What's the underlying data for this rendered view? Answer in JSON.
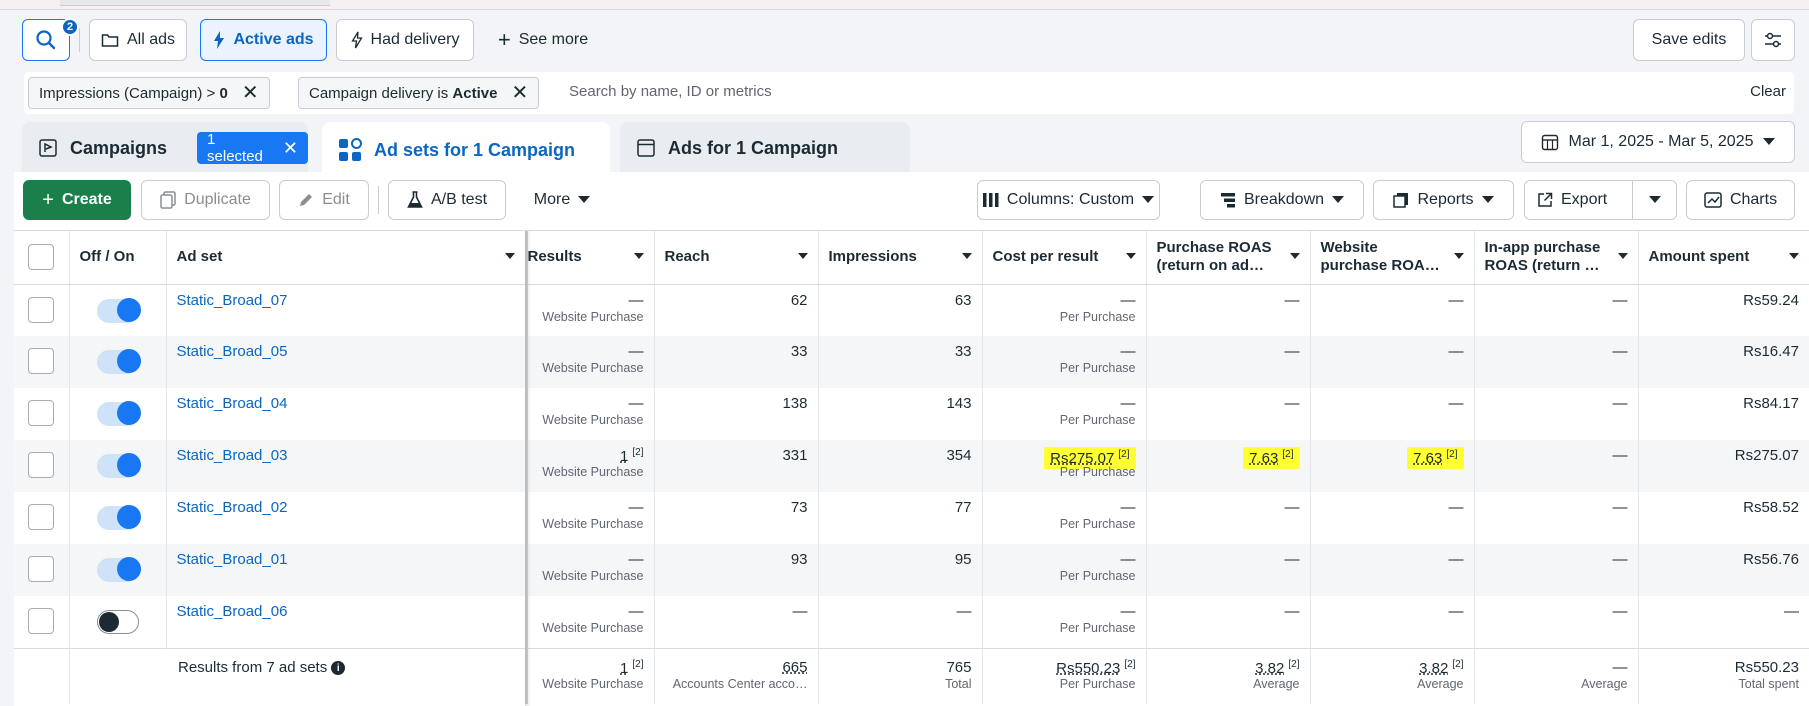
{
  "topbar": {
    "search_badge": "2",
    "all_ads": "All ads",
    "active_ads": "Active ads",
    "had_delivery": "Had delivery",
    "see_more": "See more",
    "save_edits": "Save edits"
  },
  "filters": {
    "chip1_prefix": "Impressions (Campaign) > ",
    "chip1_value": "0",
    "chip2_prefix": "Campaign delivery is ",
    "chip2_value": "Active",
    "search_placeholder": "Search by name, ID or metrics",
    "clear": "Clear"
  },
  "tabs": {
    "campaigns": "Campaigns",
    "selected": "1 selected",
    "adsets": "Ad sets for 1 Campaign",
    "ads": "Ads for 1 Campaign",
    "date_range": "Mar 1, 2025 - Mar 5, 2025"
  },
  "toolbar": {
    "create": "Create",
    "duplicate": "Duplicate",
    "edit": "Edit",
    "ab_test": "A/B test",
    "more": "More",
    "columns": "Columns: Custom",
    "breakdown": "Breakdown",
    "reports": "Reports",
    "export": "Export",
    "charts": "Charts"
  },
  "columns": {
    "onoff": "Off / On",
    "adset": "Ad set",
    "results": "Results",
    "reach": "Reach",
    "impressions": "Impressions",
    "cpr": "Cost per result",
    "proas": "Purchase ROAS (return on ad…",
    "wroas": "Website purchase ROA…",
    "iroas": "In-app purchase ROAS (return …",
    "spent": "Amount spent"
  },
  "rows": [
    {
      "name": "Static_Broad_07",
      "on": true,
      "results": "—",
      "results_sub": "Website Purchase",
      "reach": "62",
      "impressions": "63",
      "cpr": "—",
      "cpr_sub": "Per Purchase",
      "proas": "—",
      "wroas": "—",
      "iroas": "—",
      "spent": "Rs59.24"
    },
    {
      "name": "Static_Broad_05",
      "on": true,
      "results": "—",
      "results_sub": "Website Purchase",
      "reach": "33",
      "impressions": "33",
      "cpr": "—",
      "cpr_sub": "Per Purchase",
      "proas": "—",
      "wroas": "—",
      "iroas": "—",
      "spent": "Rs16.47"
    },
    {
      "name": "Static_Broad_04",
      "on": true,
      "results": "—",
      "results_sub": "Website Purchase",
      "reach": "138",
      "impressions": "143",
      "cpr": "—",
      "cpr_sub": "Per Purchase",
      "proas": "—",
      "wroas": "—",
      "iroas": "—",
      "spent": "Rs84.17"
    },
    {
      "name": "Static_Broad_03",
      "on": true,
      "results": "1",
      "results_sup": "[2]",
      "results_sub": "Website Purchase",
      "reach": "331",
      "impressions": "354",
      "cpr": "Rs275.07",
      "cpr_sup": "[2]",
      "cpr_sub": "Per Purchase",
      "proas": "7.63",
      "proas_sup": "[2]",
      "wroas": "7.63",
      "wroas_sup": "[2]",
      "iroas": "—",
      "spent": "Rs275.07"
    },
    {
      "name": "Static_Broad_02",
      "on": true,
      "results": "—",
      "results_sub": "Website Purchase",
      "reach": "73",
      "impressions": "77",
      "cpr": "—",
      "cpr_sub": "Per Purchase",
      "proas": "—",
      "wroas": "—",
      "iroas": "—",
      "spent": "Rs58.52"
    },
    {
      "name": "Static_Broad_01",
      "on": true,
      "results": "—",
      "results_sub": "Website Purchase",
      "reach": "93",
      "impressions": "95",
      "cpr": "—",
      "cpr_sub": "Per Purchase",
      "proas": "—",
      "wroas": "—",
      "iroas": "—",
      "spent": "Rs56.76"
    },
    {
      "name": "Static_Broad_06",
      "on": false,
      "results": "—",
      "results_sub": "Website Purchase",
      "reach": "—",
      "impressions": "—",
      "cpr": "—",
      "cpr_sub": "Per Purchase",
      "proas": "—",
      "wroas": "—",
      "iroas": "—",
      "spent": "—"
    }
  ],
  "footer": {
    "label": "Results from 7 ad sets",
    "results": "1",
    "results_sup": "[2]",
    "results_sub": "Website Purchase",
    "reach": "665",
    "reach_sub": "Accounts Center acco…",
    "impressions": "765",
    "impressions_sub": "Total",
    "cpr": "Rs550.23",
    "cpr_sup": "[2]",
    "cpr_sub": "Per Purchase",
    "proas": "3.82",
    "proas_sup": "[2]",
    "proas_sub": "Average",
    "wroas": "3.82",
    "wroas_sup": "[2]",
    "wroas_sub": "Average",
    "iroas": "—",
    "iroas_sub": "Average",
    "spent": "Rs550.23",
    "spent_sub": "Total spent"
  },
  "colors": {
    "accent": "#1877f2",
    "link": "#0a66c2",
    "create": "#1a7f4b",
    "highlight": "#ffff33"
  }
}
